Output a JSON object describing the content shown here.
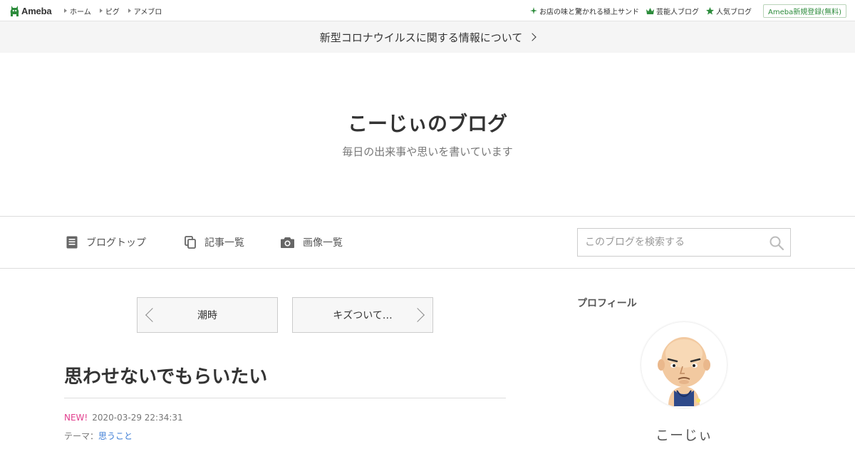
{
  "topbar": {
    "logo_text": "Ameba",
    "left_links": [
      "ホーム",
      "ピグ",
      "アメブロ"
    ],
    "right_links": [
      {
        "label": "お店の味と驚かれる極上サンド",
        "icon": "sparkle-icon"
      },
      {
        "label": "芸能人ブログ",
        "icon": "crown-icon"
      },
      {
        "label": "人気ブログ",
        "icon": "star-icon"
      }
    ],
    "register_label": "Ameba新規登録(無料)",
    "accent": "#2d8c3c"
  },
  "notice": {
    "text": "新型コロナウイルスに関する情報について"
  },
  "header": {
    "title": "こーじぃのブログ",
    "description": "毎日の出来事や思いを書いています"
  },
  "blog_nav": {
    "items": [
      {
        "label": "ブログトップ",
        "icon": "document-icon"
      },
      {
        "label": "記事一覧",
        "icon": "copy-icon"
      },
      {
        "label": "画像一覧",
        "icon": "camera-icon"
      }
    ],
    "search_placeholder": "このブログを検索する"
  },
  "pager": {
    "prev_label": "潮時",
    "next_label": "キズついて…"
  },
  "entry": {
    "title": "思わせないでもらいたい",
    "new_badge": "NEW!",
    "datetime": "2020-03-29 22:34:31",
    "theme_prefix": "テーマ：",
    "theme": "思うこと"
  },
  "sidebar": {
    "heading": "プロフィール",
    "profile_name": "こーじぃ"
  }
}
